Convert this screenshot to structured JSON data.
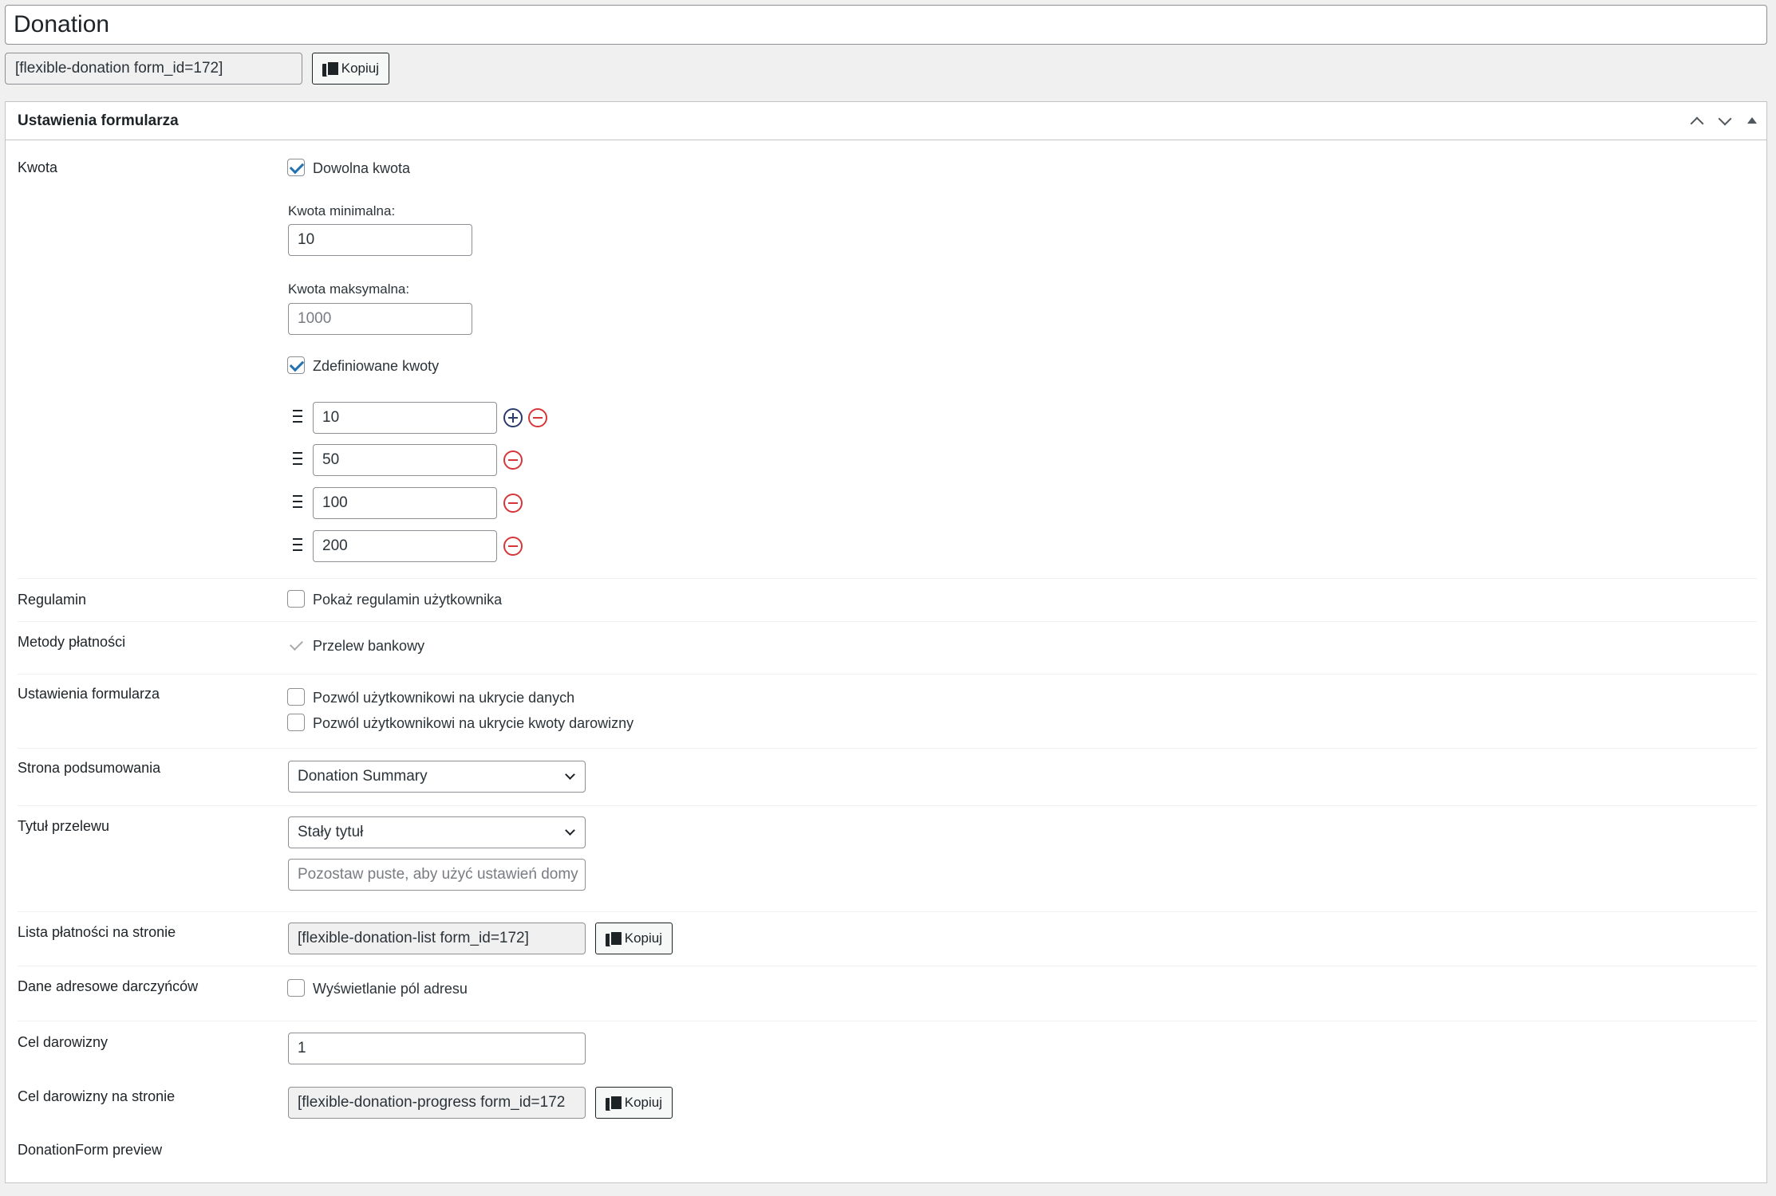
{
  "post_title": "Donation",
  "shortcode_top": "[flexible-donation form_id=172]",
  "copy_label": "Kopiuj",
  "panel": {
    "title": "Ustawienia formularza"
  },
  "kwota": {
    "label": "Kwota",
    "any_amount_label": "Dowolna kwota",
    "any_amount_checked": true,
    "min_label": "Kwota minimalna:",
    "min_value": "10",
    "max_label": "Kwota maksymalna:",
    "max_placeholder": "1000",
    "predefined_label": "Zdefiniowane kwoty",
    "predefined_checked": true,
    "amounts": [
      "10",
      "50",
      "100",
      "200"
    ]
  },
  "regulamin": {
    "label": "Regulamin",
    "checkbox_label": "Pokaż regulamin użytkownika",
    "checked": false
  },
  "metody": {
    "label": "Metody płatności",
    "checkbox_label": "Przelew bankowy",
    "checked": true
  },
  "ustawienia": {
    "label": "Ustawienia formularza",
    "hide_data_label": "Pozwól użytkownikowi na ukrycie danych",
    "hide_amount_label": "Pozwól użytkownikowi na ukrycie kwoty darowizny"
  },
  "podsumowanie": {
    "label": "Strona podsumowania",
    "selected": "Donation Summary"
  },
  "tytul": {
    "label": "Tytuł przelewu",
    "selected": "Stały tytuł",
    "placeholder": "Pozostaw puste, aby użyć ustawień domy"
  },
  "lista": {
    "label": "Lista płatności na stronie",
    "shortcode": "[flexible-donation-list form_id=172]"
  },
  "adresowe": {
    "label": "Dane adresowe darczyńców",
    "checkbox_label": "Wyświetlanie pól adresu",
    "checked": false
  },
  "cel": {
    "label": "Cel darowizny",
    "value": "1"
  },
  "cel_strona": {
    "label": "Cel darowizny na stronie",
    "shortcode": "[flexible-donation-progress form_id=172"
  },
  "preview": {
    "label": "DonationForm preview"
  },
  "colors": {
    "accent": "#2271b1",
    "danger": "#d63638",
    "add": "#2c3b6e"
  }
}
